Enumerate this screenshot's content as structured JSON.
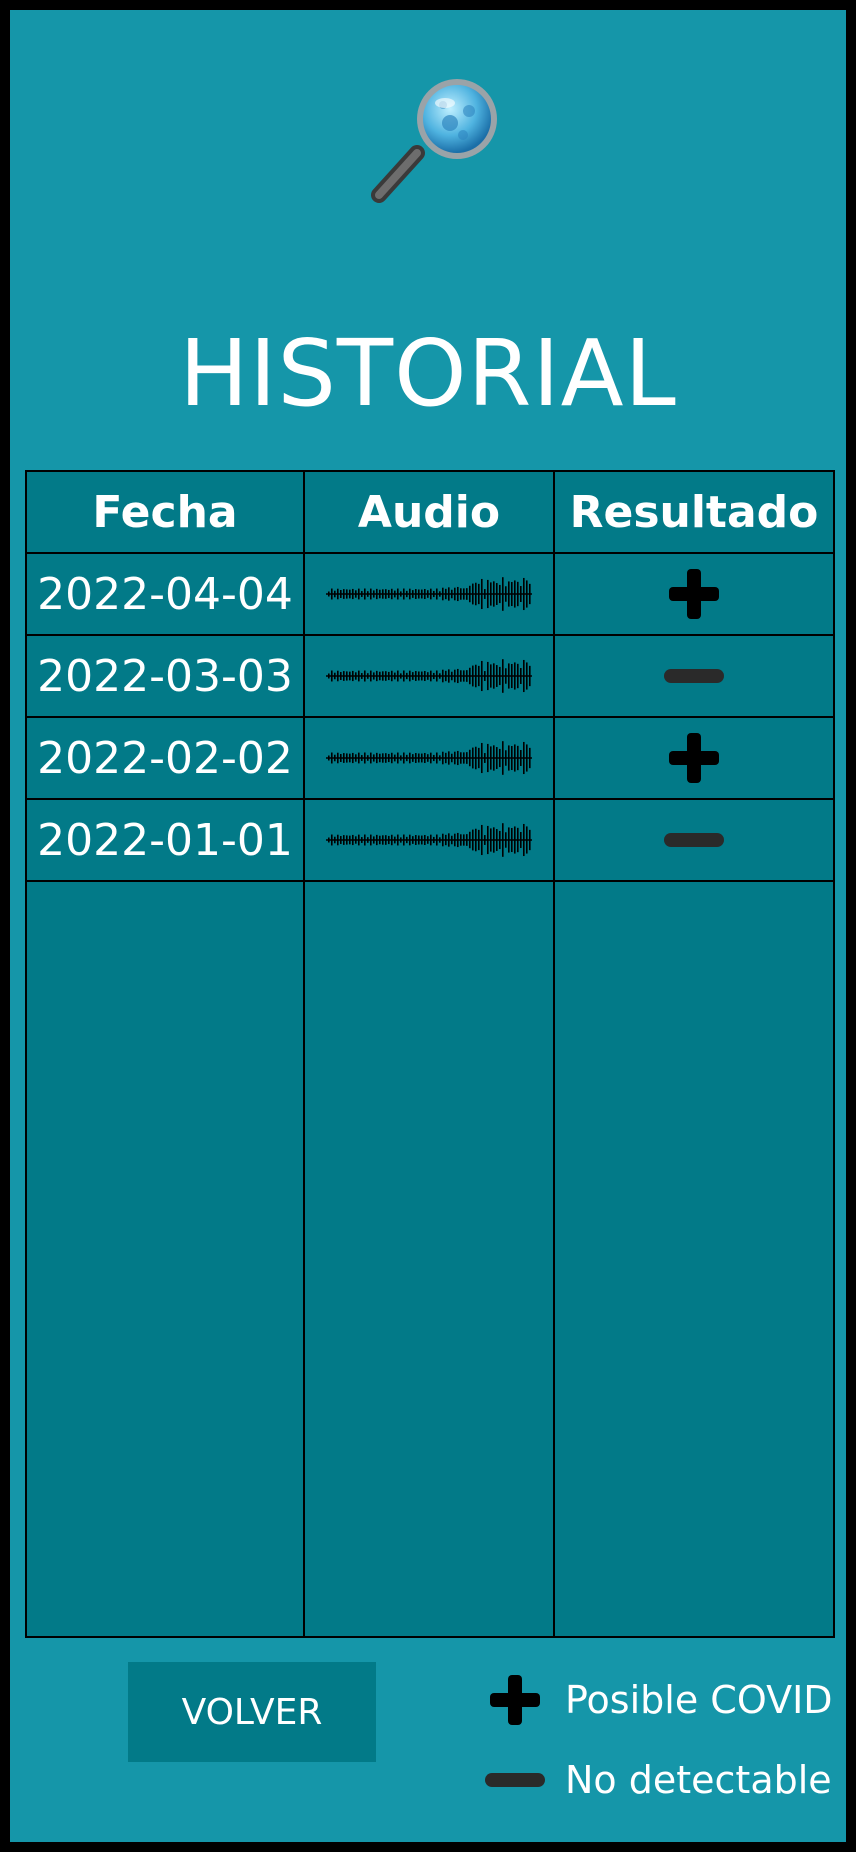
{
  "header": {
    "title": "HISTORIAL",
    "logo_icon": "magnifier-virus-icon"
  },
  "table": {
    "columns": [
      "Fecha",
      "Audio",
      "Resultado"
    ],
    "rows": [
      {
        "fecha": "2022-04-04",
        "audio": "waveform-icon",
        "resultado": "positive"
      },
      {
        "fecha": "2022-03-03",
        "audio": "waveform-icon",
        "resultado": "negative"
      },
      {
        "fecha": "2022-02-02",
        "audio": "waveform-icon",
        "resultado": "positive"
      },
      {
        "fecha": "2022-01-01",
        "audio": "waveform-icon",
        "resultado": "negative"
      }
    ]
  },
  "footer": {
    "volver_label": "VOLVER",
    "legend": [
      {
        "icon": "plus-icon",
        "label": "Posible COVID"
      },
      {
        "icon": "minus-icon",
        "label": "No detectable"
      }
    ]
  },
  "colors": {
    "background": "#1596a9",
    "table_bg": "#027a88",
    "border": "#000000",
    "positive": "#000000",
    "negative": "#222222"
  }
}
